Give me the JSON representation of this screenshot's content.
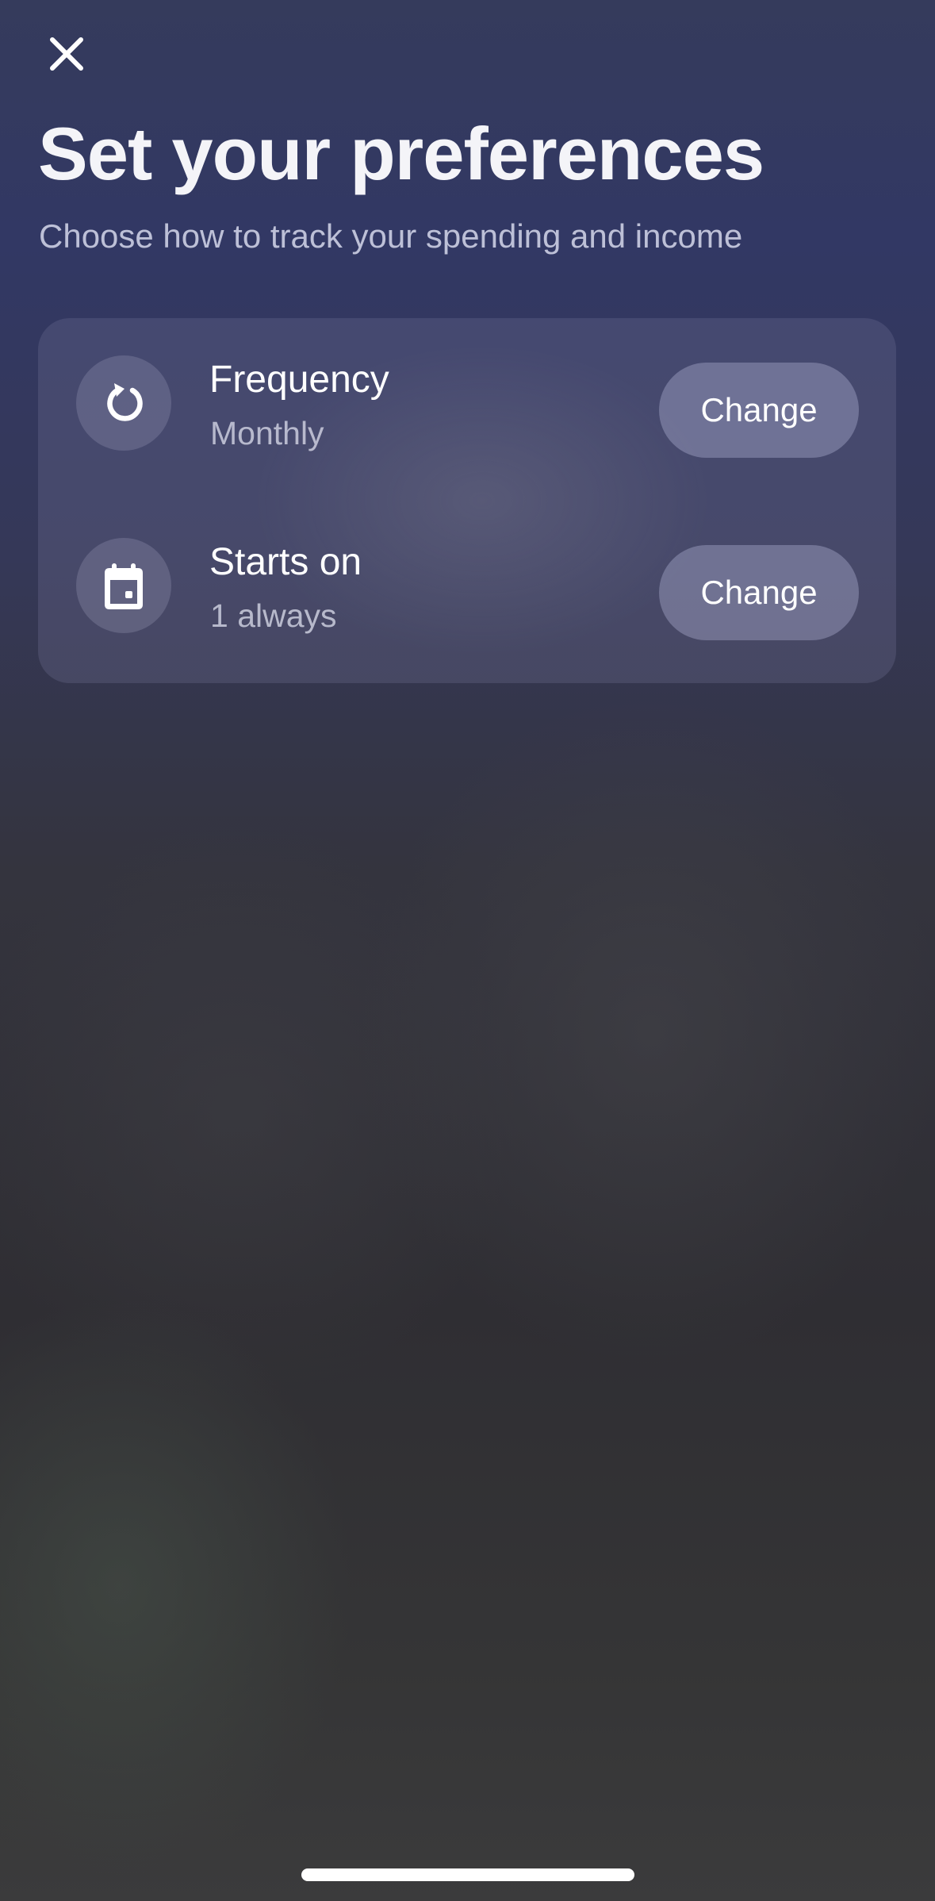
{
  "header": {
    "close_icon": "close-icon",
    "title": "Set your preferences",
    "subtitle": "Choose how to track your spending and income"
  },
  "preferences": [
    {
      "icon": "refresh-icon",
      "label": "Frequency",
      "value": "Monthly",
      "button_label": "Change"
    },
    {
      "icon": "calendar-icon",
      "label": "Starts on",
      "value": "1 always",
      "button_label": "Change"
    }
  ],
  "colors": {
    "background_top": "#353b5c",
    "background_bottom": "#3b3b3c",
    "text_primary": "#ffffff"
  }
}
